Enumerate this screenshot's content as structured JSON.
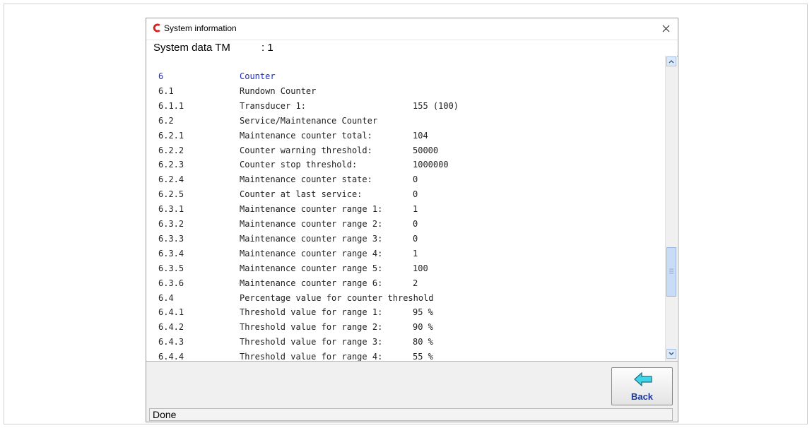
{
  "window": {
    "title": "System information"
  },
  "header": {
    "label": "System data TM",
    "value": ": 1"
  },
  "rows": [
    {
      "num": "6",
      "label": "Counter",
      "value": "",
      "heading": true
    },
    {
      "num": "6.1",
      "label": "Rundown Counter",
      "value": ""
    },
    {
      "num": "6.1.1",
      "label": "Transducer 1:",
      "value": "155 (100)"
    },
    {
      "num": "6.2",
      "label": "Service/Maintenance Counter",
      "value": ""
    },
    {
      "num": "6.2.1",
      "label": "Maintenance counter total:",
      "value": "104"
    },
    {
      "num": "6.2.2",
      "label": "Counter warning threshold:",
      "value": "50000"
    },
    {
      "num": "6.2.3",
      "label": "Counter stop threshold:",
      "value": "1000000"
    },
    {
      "num": "6.2.4",
      "label": "Maintenance counter state:",
      "value": "0"
    },
    {
      "num": "6.2.5",
      "label": "Counter at last service:",
      "value": "0"
    },
    {
      "num": "6.3.1",
      "label": "Maintenance counter range 1:",
      "value": "1"
    },
    {
      "num": "6.3.2",
      "label": "Maintenance counter range 2:",
      "value": "0"
    },
    {
      "num": "6.3.3",
      "label": "Maintenance counter range 3:",
      "value": "0"
    },
    {
      "num": "6.3.4",
      "label": "Maintenance counter range 4:",
      "value": "1"
    },
    {
      "num": "6.3.5",
      "label": "Maintenance counter range 5:",
      "value": "100"
    },
    {
      "num": "6.3.6",
      "label": "Maintenance counter range 6:",
      "value": "2"
    },
    {
      "num": "6.4",
      "label": "Percentage value for counter threshold",
      "value": ""
    },
    {
      "num": "6.4.1",
      "label": "Threshold value for range 1:",
      "value": "95 %"
    },
    {
      "num": "6.4.2",
      "label": "Threshold value for range 2:",
      "value": "90 %"
    },
    {
      "num": "6.4.3",
      "label": "Threshold value for range 3:",
      "value": "80 %"
    },
    {
      "num": "6.4.4",
      "label": "Threshold value for range 4:",
      "value": "55 %"
    }
  ],
  "buttons": {
    "back_label": "Back"
  },
  "status": {
    "text": "Done"
  },
  "colors": {
    "heading_text": "#1c2ed0",
    "logo_red": "#d81e1e",
    "back_arrow": "#3fd3e6"
  }
}
